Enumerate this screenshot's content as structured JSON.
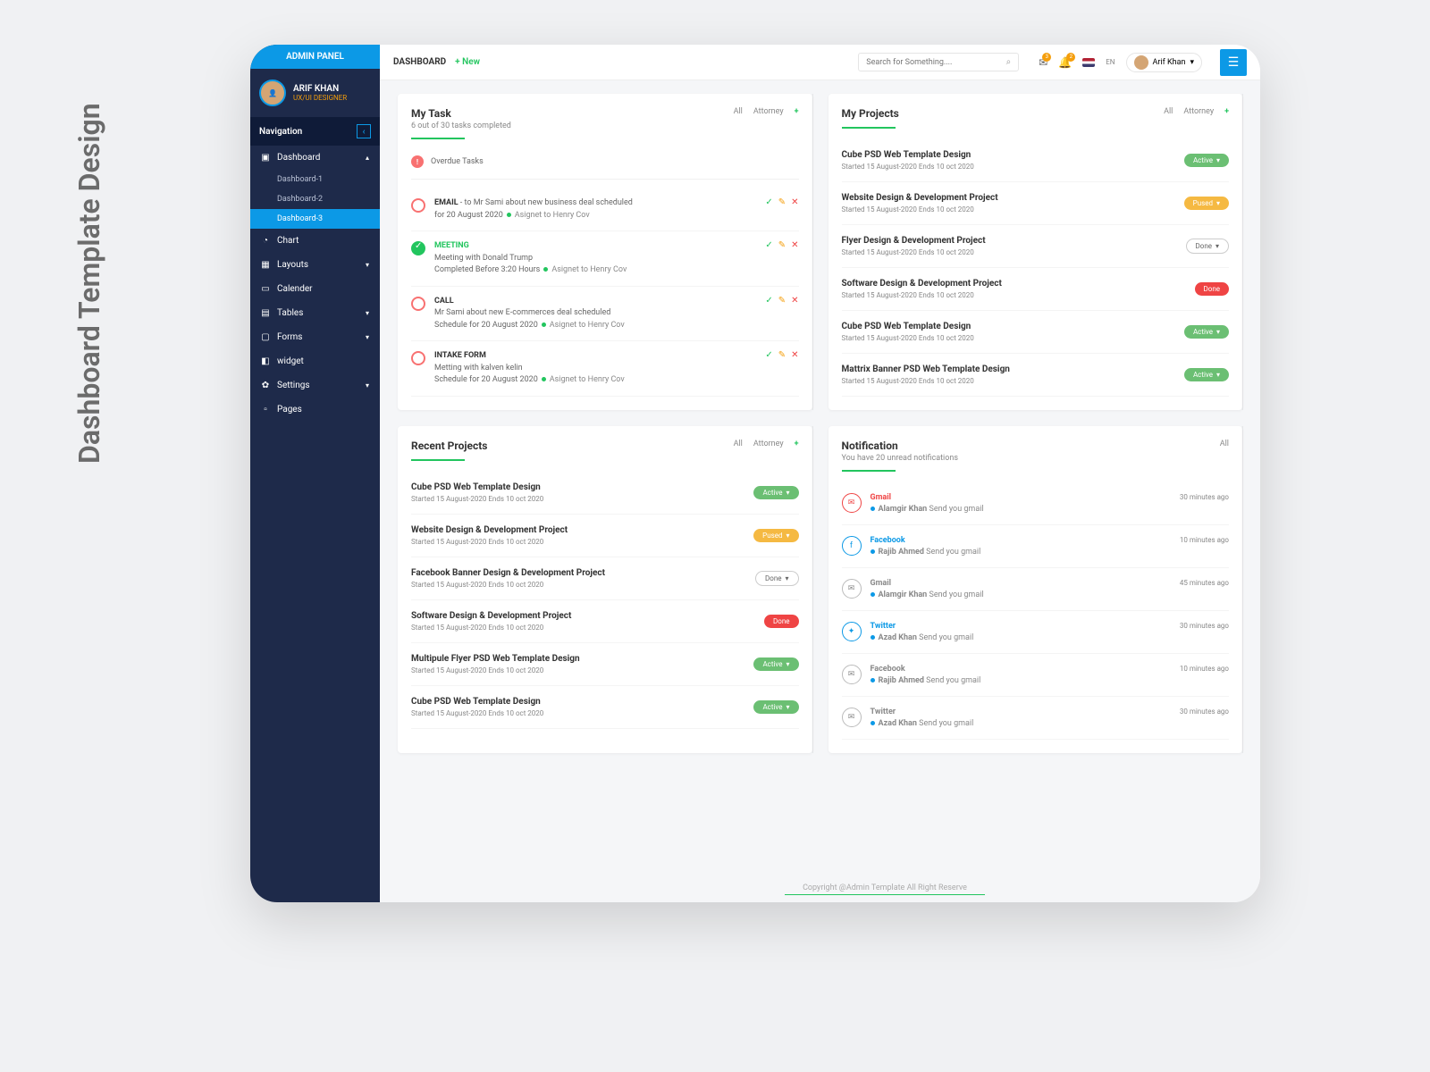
{
  "page_heading": "Dashboard Template Design",
  "sidebar": {
    "brand": "ADMIN PANEL",
    "user_name": "ARIF KHAN",
    "user_role": "UX/UI DESIGNER",
    "nav_label": "Navigation",
    "items": [
      {
        "label": "Dashboard",
        "expanded": true,
        "children": [
          {
            "label": "Dashboard-1"
          },
          {
            "label": "Dashboard-2"
          },
          {
            "label": "Dashboard-3",
            "active": true
          }
        ]
      },
      {
        "label": "Chart"
      },
      {
        "label": "Layouts",
        "caret": true
      },
      {
        "label": "Calender"
      },
      {
        "label": "Tables",
        "caret": true
      },
      {
        "label": "Forms",
        "caret": true
      },
      {
        "label": "widget"
      },
      {
        "label": "Settings",
        "caret": true
      },
      {
        "label": "Pages"
      }
    ]
  },
  "topbar": {
    "title": "DASHBOARD",
    "new": "+ New",
    "search_placeholder": "Search for Something....",
    "lang": "EN",
    "user": "Arif Khan",
    "badge1": "3",
    "badge2": "2"
  },
  "my_task": {
    "title": "My Task",
    "subtitle": "6 out of 30 tasks completed",
    "tabs": {
      "all": "All",
      "attorney": "Attorney"
    },
    "overdue": "Overdue Tasks",
    "tasks": [
      {
        "title": "EMAIL",
        "done": false,
        "detail_pre": " - to Mr Sami about new business deal scheduled",
        "detail_post": "for 20 August 2020",
        "assigned": "Asignet to Henry Cov"
      },
      {
        "title": "MEETING",
        "done": true,
        "detail_pre": "Meeting with Donald Trump",
        "detail_post": "Completed Before 3:20 Hours",
        "assigned": "Asignet to Henry Cov"
      },
      {
        "title": "CALL",
        "done": false,
        "detail_pre": "Mr Sami about new E-commerces deal scheduled",
        "detail_post": "Schedule for 20 August 2020",
        "assigned": "Asignet to Henry Cov"
      },
      {
        "title": "INTAKE FORM",
        "done": false,
        "detail_pre": "Metting with kalven kelin",
        "detail_post": "Schedule for 20 August 2020",
        "assigned": "Asignet to Henry Cov"
      }
    ]
  },
  "my_projects": {
    "title": "My Projects",
    "tabs": {
      "all": "All",
      "attorney": "Attorney"
    },
    "items": [
      {
        "title": "Cube PSD Web Template Design",
        "dates": "Started 15 August-2020 Ends  10 oct 2020",
        "status": "Active",
        "kind": "active"
      },
      {
        "title": "Website Design & Development Project",
        "dates": "Started 15 August-2020 Ends  10 oct 2020",
        "status": "Pused",
        "kind": "pused"
      },
      {
        "title": "Flyer Design & Development Project",
        "dates": "Started 15 August-2020 Ends  10 oct 2020",
        "status": "Done",
        "kind": "done-outline"
      },
      {
        "title": "Software Design & Development Project",
        "dates": "Started 15 August-2020 Ends  10 oct 2020",
        "status": "Done",
        "kind": "done-red"
      },
      {
        "title": "Cube PSD Web Template Design",
        "dates": "Started 15 August-2020 Ends  10 oct 2020",
        "status": "Active",
        "kind": "active"
      },
      {
        "title": "Mattrix Banner PSD Web Template Design",
        "dates": "Started 15 August-2020 Ends  10 oct 2020",
        "status": "Active",
        "kind": "active"
      }
    ]
  },
  "recent_projects": {
    "title": "Recent Projects",
    "tabs": {
      "all": "All",
      "attorney": "Attorney"
    },
    "items": [
      {
        "title": "Cube PSD Web Template Design",
        "dates": "Started 15 August-2020 Ends  10 oct 2020",
        "status": "Active",
        "kind": "active"
      },
      {
        "title": "Website Design & Development Project",
        "dates": "Started 15 August-2020 Ends  10 oct 2020",
        "status": "Pused",
        "kind": "pused"
      },
      {
        "title": "Facebook Banner Design & Development Project",
        "dates": "Started 15 August-2020 Ends  10 oct 2020",
        "status": "Done",
        "kind": "done-outline"
      },
      {
        "title": "Software Design & Development Project",
        "dates": "Started 15 August-2020 Ends  10 oct 2020",
        "status": "Done",
        "kind": "done-red"
      },
      {
        "title": "Multipule Flyer PSD Web Template Design",
        "dates": "Started 15 August-2020 Ends  10 oct 2020",
        "status": "Active",
        "kind": "active"
      },
      {
        "title": "Cube PSD Web Template Design",
        "dates": "Started 15 August-2020 Ends  10 oct 2020",
        "status": "Active",
        "kind": "active"
      }
    ]
  },
  "notifications": {
    "title": "Notification",
    "subtitle": "You have 20 unread notifications",
    "all": "All",
    "items": [
      {
        "src": "Gmail",
        "icon": "gmail",
        "who": "Alamgir  Khan",
        "msg": "Send you gmail",
        "time": "30 minutes ago",
        "color": "red"
      },
      {
        "src": "Facebook",
        "icon": "fb",
        "who": "Rajib Ahmed",
        "msg": "Send you gmail",
        "time": "10 minutes ago",
        "color": "blue"
      },
      {
        "src": "Gmail",
        "icon": "gray",
        "who": "Alamgir  Khan",
        "msg": "Send you gmail",
        "time": "45 minutes ago",
        "color": "gray"
      },
      {
        "src": "Twitter",
        "icon": "tw",
        "who": "Azad  Khan",
        "msg": "Send you gmail",
        "time": "30 minutes ago",
        "color": "blue"
      },
      {
        "src": "Facebook",
        "icon": "gray",
        "who": "Rajib Ahmed",
        "msg": "Send you gmail",
        "time": "10 minutes ago",
        "color": "gray"
      },
      {
        "src": "Twitter",
        "icon": "gray",
        "who": "Azad  Khan",
        "msg": "Send you gmail",
        "time": "30 minutes ago",
        "color": "gray"
      }
    ]
  },
  "footer": "Copyright @Admin Template All Right Reserve"
}
